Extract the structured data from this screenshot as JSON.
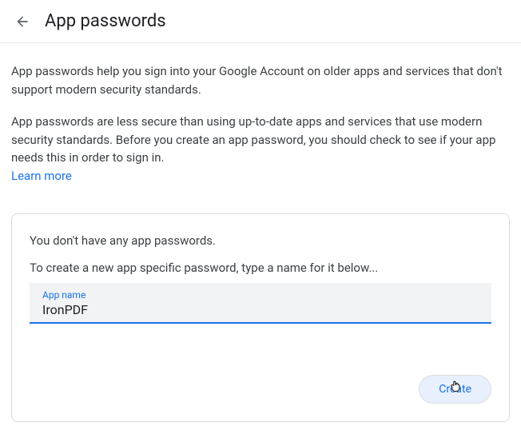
{
  "header": {
    "title": "App passwords"
  },
  "description": {
    "para1": "App passwords help you sign into your Google Account on older apps and services that don't support modern security standards.",
    "para2": "App passwords are less secure than using up-to-date apps and services that use modern security standards. Before you create an app password, you should check to see if your app needs this in order to sign in.",
    "learn_more": "Learn more"
  },
  "card": {
    "empty_state": "You don't have any app passwords.",
    "instruction": "To create a new app specific password, type a name for it below...",
    "input_label": "App name",
    "input_value": "IronPDF",
    "create_label": "Create"
  }
}
